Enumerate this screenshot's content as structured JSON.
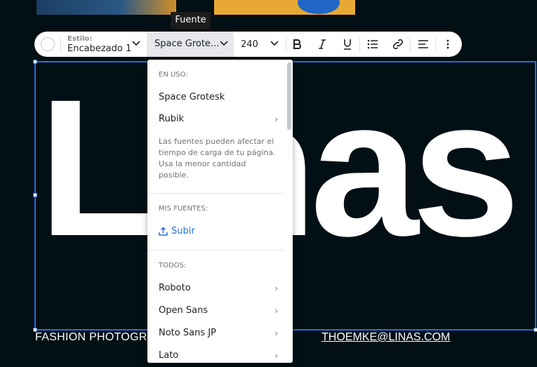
{
  "tooltip": "Fuente",
  "toolbar": {
    "style_label": "Estilo:",
    "style_value": "Encabezado 1",
    "font_value": "Space Grote...",
    "size_value": "240"
  },
  "headline": "Linas",
  "footer": {
    "left": "FASHION PHOTOGRA",
    "right": "THOEMKE@LINAS.COM"
  },
  "dropdown": {
    "in_use_header": "EN USO:",
    "in_use": [
      "Space Grotesk",
      "Rubik"
    ],
    "note": "Las fuentes pueden afectar el tiempo de carga de tu página. Usa la menor cantidad posible.",
    "my_fonts_header": "MIS FUENTES:",
    "upload_label": "Subir",
    "all_header": "TODOS:",
    "all": [
      "Roboto",
      "Open Sans",
      "Noto Sans JP",
      "Lato"
    ]
  },
  "colors": {
    "background": "#020f14",
    "accent": "#1f6fe0"
  }
}
